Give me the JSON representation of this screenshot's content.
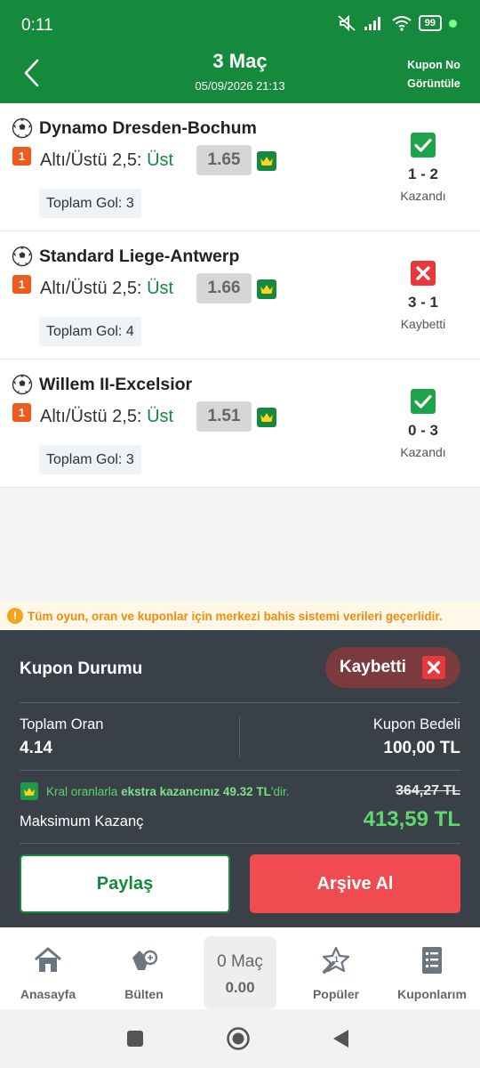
{
  "status_bar": {
    "time": "0:11",
    "battery": "99"
  },
  "header": {
    "title": "3 Maç",
    "subtitle": "05/09/2026 21:13",
    "right_action": "Kupon No Görüntüle"
  },
  "matches": [
    {
      "teams": "Dynamo Dresden-Bochum",
      "badge": "1",
      "market": "Altı/Üstü 2,5:",
      "pick": "Üst",
      "odd": "1.65",
      "total_goals": "Toplam Gol: 3",
      "score": "1 - 2",
      "result": "Kazandı",
      "won": true
    },
    {
      "teams": "Standard Liege-Antwerp",
      "badge": "1",
      "market": "Altı/Üstü 2,5:",
      "pick": "Üst",
      "odd": "1.66",
      "total_goals": "Toplam Gol: 4",
      "score": "3 - 1",
      "result": "Kaybetti",
      "won": false
    },
    {
      "teams": "Willem II-Excelsior",
      "badge": "1",
      "market": "Altı/Üstü 2,5:",
      "pick": "Üst",
      "odd": "1.51",
      "total_goals": "Toplam Gol: 3",
      "score": "0 - 3",
      "result": "Kazandı",
      "won": true
    }
  ],
  "info_banner": "Tüm oyun, oran ve kuponlar için merkezi bahis sistemi verileri geçerlidir.",
  "summary": {
    "title": "Kupon Durumu",
    "status": "Kaybetti",
    "total_odds_label": "Toplam Oran",
    "total_odds": "4.14",
    "stake_label": "Kupon Bedeli",
    "stake": "100,00 TL",
    "king_prefix": "Kral oranlarla",
    "king_extra": "ekstra kazancınız 49.32 TL",
    "king_suffix": "'dir.",
    "old_max": "364,27 TL",
    "max_label": "Maksimum Kazanç",
    "max_value": "413,59 TL",
    "share_label": "Paylaş",
    "archive_label": "Arşive Al"
  },
  "nav": {
    "home": "Anasayfa",
    "bulletin": "Bülten",
    "center_count": "0 Maç",
    "center_value": "0.00",
    "popular": "Popüler",
    "coupons": "Kuponlarım"
  },
  "colors": {
    "brand_green": "#168a3c",
    "loss_red": "#e8383c",
    "panel_dark": "#3a4047"
  }
}
